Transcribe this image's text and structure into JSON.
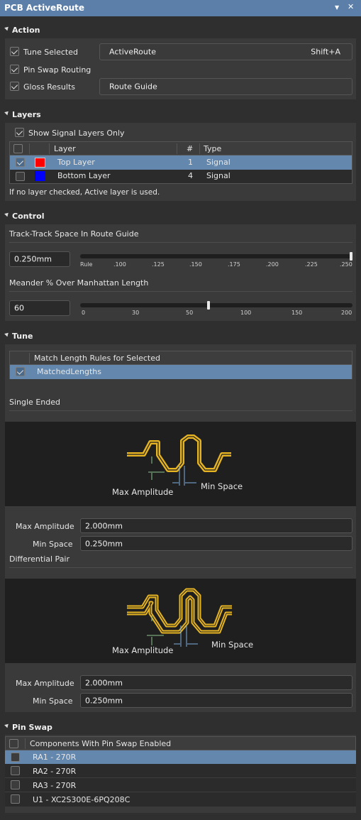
{
  "window": {
    "title": "PCB ActiveRoute"
  },
  "sections": {
    "action": "Action",
    "layers": "Layers",
    "control": "Control",
    "tune": "Tune",
    "pinswap": "Pin Swap"
  },
  "action": {
    "tune_selected": "Tune Selected",
    "pin_swap_routing": "Pin Swap Routing",
    "gloss_results": "Gloss Results",
    "activeroute_button": "ActiveRoute",
    "activeroute_shortcut": "Shift+A",
    "route_guide_button": "Route Guide"
  },
  "layers": {
    "show_signal_only": "Show Signal Layers Only",
    "columns": {
      "layer": "Layer",
      "num": "#",
      "type": "Type"
    },
    "rows": [
      {
        "name": "Top Layer",
        "num": "1",
        "type": "Signal",
        "color": "#ff0000",
        "checked": true
      },
      {
        "name": "Bottom Layer",
        "num": "4",
        "type": "Signal",
        "color": "#0000ff",
        "checked": false
      }
    ],
    "note": "If no layer checked, Active layer is used."
  },
  "control": {
    "track_label": "Track-Track Space In Route Guide",
    "track_value": "0.250mm",
    "track_scale": [
      "Rule",
      ".100",
      ".125",
      ".150",
      ".175",
      ".200",
      ".225",
      ".250"
    ],
    "track_slider_level": 1.0,
    "meander_label": "Meander % Over Manhattan Length",
    "meander_value": "60",
    "meander_scale": [
      "0",
      "30",
      "50",
      "100",
      "150",
      "200"
    ],
    "meander_slider_value": 60
  },
  "tune": {
    "rules_header": "Match Length Rules for Selected",
    "rules": [
      "MatchedLengths"
    ],
    "single_ended": "Single Ended",
    "differential_pair": "Differential Pair",
    "diagram_max_amplitude": "Max Amplitude",
    "diagram_min_space": "Min Space",
    "se_max_amplitude_label": "Max Amplitude",
    "se_max_amplitude": "2.000mm",
    "se_min_space_label": "Min Space",
    "se_min_space": "0.250mm",
    "dp_max_amplitude_label": "Max Amplitude",
    "dp_max_amplitude": "2.000mm",
    "dp_min_space_label": "Min Space",
    "dp_min_space": "0.250mm",
    "trace_color": "#e6b422"
  },
  "pinswap": {
    "header": "Components With Pin Swap Enabled",
    "items": [
      "RA1 - 270R",
      "RA2 - 270R",
      "RA3 - 270R",
      "U1 - XC2S300E-6PQ208C"
    ]
  },
  "icons": {
    "collapse": "triangle-icon",
    "pin": "pin-icon",
    "close": "close-icon",
    "check": "check-icon"
  }
}
